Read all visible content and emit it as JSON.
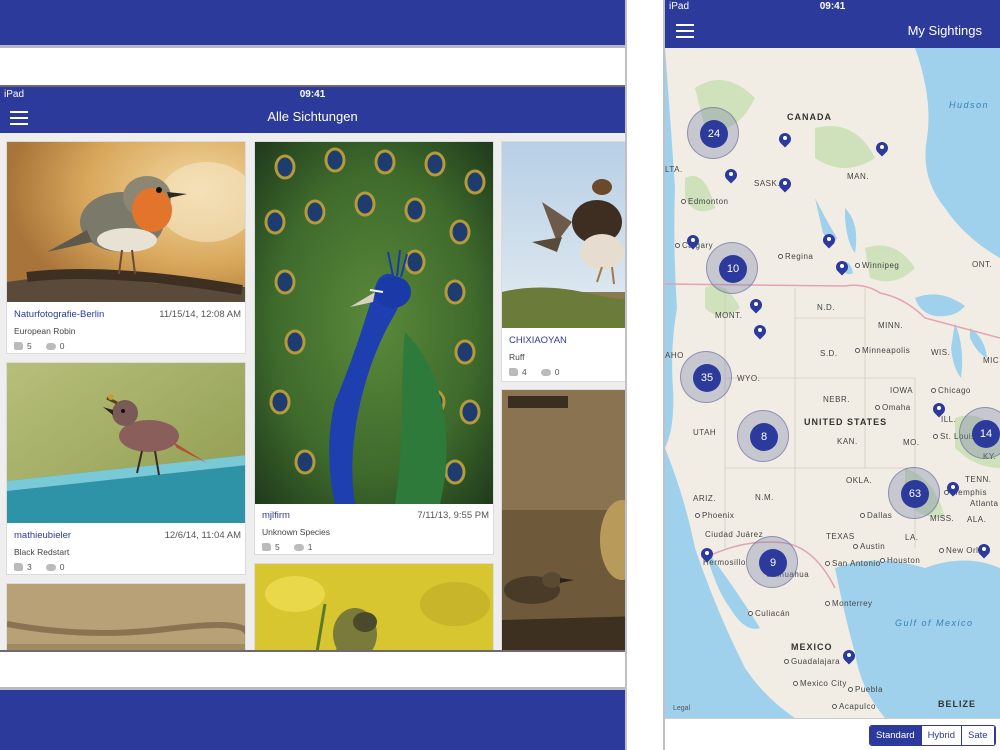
{
  "left": {
    "carrier": "iPad",
    "time": "09:41",
    "title": "Alle Sichtungen",
    "cards": [
      {
        "user": "Naturfotografie-Berlin",
        "date": "11/15/14, 12:08 AM",
        "species": "European Robin",
        "likes": "5",
        "comments": "0"
      },
      {
        "user": "mathieubieler",
        "date": "12/6/14, 11:04 AM",
        "species": "Black Redstart",
        "likes": "3",
        "comments": "0"
      },
      {
        "user": "mjlfirm",
        "date": "7/11/13, 9:55 PM",
        "species": "Unknown Species",
        "likes": "5",
        "comments": "1"
      },
      {
        "user": "CHIXIAOYAN",
        "date": "",
        "species": "Ruff",
        "likes": "4",
        "comments": "0"
      }
    ]
  },
  "right": {
    "carrier": "iPad",
    "time": "09:41",
    "title": "My Sightings",
    "clusters": [
      "24",
      "10",
      "35",
      "8",
      "63",
      "9",
      "14"
    ],
    "labels": {
      "canada": "CANADA",
      "hudson": "Hudson",
      "lta": "LTA.",
      "sask": "SASK.",
      "man": "MAN.",
      "edmonton": "Edmonton",
      "calgary": "Calgary",
      "regina": "Regina",
      "winnipeg": "Winnipeg",
      "ont": "ONT.",
      "mont": "MONT.",
      "nd": "N.D.",
      "minn": "MINN.",
      "idaho": "AHO",
      "wyo": "WYO.",
      "sd": "S.D.",
      "minneapolis": "Minneapolis",
      "wis": "WIS.",
      "mic": "MIC",
      "iowa": "IOWA",
      "nebr": "NEBR.",
      "chicago": "Chicago",
      "omaha": "Omaha",
      "ill": "ILL.",
      "utah": "UTAH",
      "us": "UNITED STATES",
      "kan": "KAN.",
      "mo": "MO.",
      "stlouis": "St. Louis",
      "ky": "KY.",
      "tenn": "TENN.",
      "okla": "OKLA.",
      "ariz": "ARIZ.",
      "nm": "N.M.",
      "memphis": "Memphis",
      "atlanta": "Atlanta",
      "phoenix": "Phoenix",
      "dallas": "Dallas",
      "miss": "MISS.",
      "ala": "ALA.",
      "ciudadjuarez": "Ciudad Juárez",
      "texas": "TEXAS",
      "la": "LA.",
      "austin": "Austin",
      "hermosillo": "Hermosillo",
      "chihuahua": "Chihuahua",
      "sanantonio": "San Antonio",
      "houston": "Houston",
      "neworleans": "New Orle",
      "culiacan": "Culiacán",
      "monterrey": "Monterrey",
      "gulf": "Gulf of Mexico",
      "mexico": "MEXICO",
      "guadalajara": "Guadalajara",
      "mexicocity": "Mexico City",
      "puebla": "Puebla",
      "acapulco": "Acapulco",
      "belize": "BELIZE",
      "legal": "Legal"
    },
    "map_types": [
      "Standard",
      "Hybrid",
      "Sate"
    ]
  }
}
